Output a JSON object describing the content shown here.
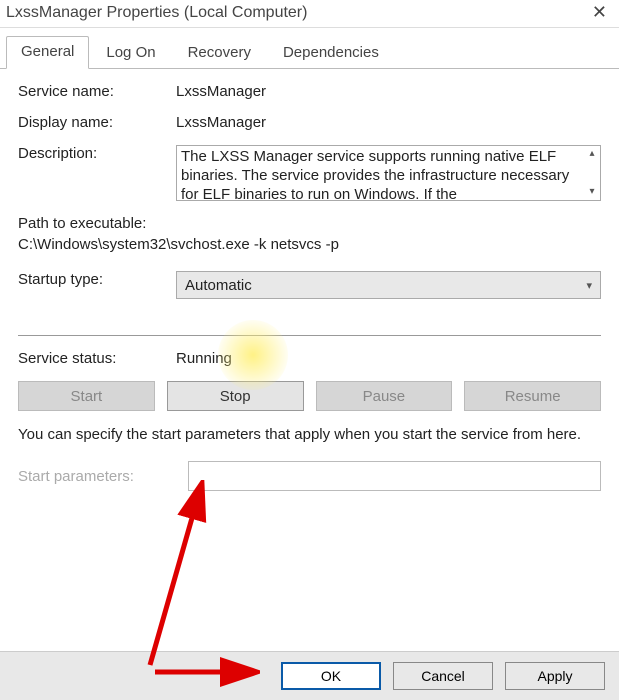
{
  "window": {
    "title": "LxssManager Properties (Local Computer)"
  },
  "tabs": {
    "general": "General",
    "logon": "Log On",
    "recovery": "Recovery",
    "dependencies": "Dependencies"
  },
  "fields": {
    "service_name_label": "Service name:",
    "service_name": "LxssManager",
    "display_name_label": "Display name:",
    "display_name": "LxssManager",
    "description_label": "Description:",
    "description": "The LXSS Manager service supports running native ELF binaries. The service provides the infrastructure necessary for ELF binaries to run on Windows. If the",
    "path_label": "Path to executable:",
    "path": "C:\\Windows\\system32\\svchost.exe -k netsvcs -p",
    "startup_label": "Startup type:",
    "startup_type": "Automatic",
    "status_label": "Service status:",
    "status": "Running",
    "help_text": "You can specify the start parameters that apply when you start the service from here.",
    "start_params_label": "Start parameters:",
    "start_params": ""
  },
  "service_buttons": {
    "start": "Start",
    "stop": "Stop",
    "pause": "Pause",
    "resume": "Resume"
  },
  "dialog_buttons": {
    "ok": "OK",
    "cancel": "Cancel",
    "apply": "Apply"
  }
}
